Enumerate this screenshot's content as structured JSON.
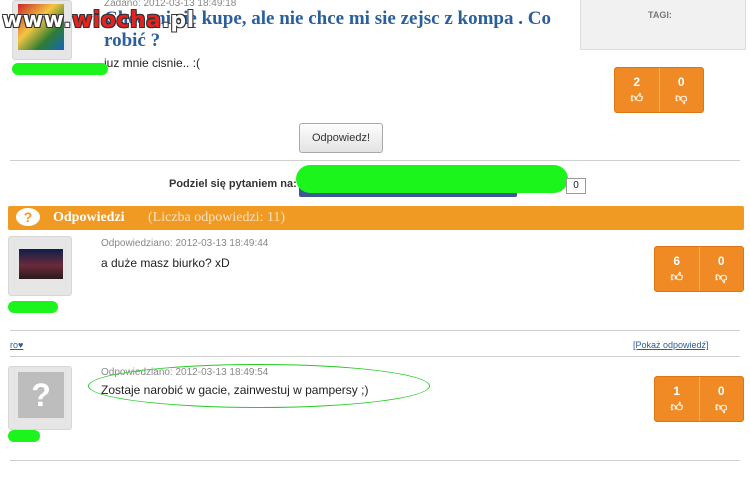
{
  "watermark": {
    "prefix": "www.",
    "red": "wiocha",
    "suffix": ".pl"
  },
  "question": {
    "date": "Zadano: 2012-03-13 18:49:18",
    "title": "Chce mi się kupe, ale nie chce mi sie zejsc z kompa . Co robić ?",
    "body": "juz mnie cisnie.. :(",
    "reply_button": "Odpowiedz!",
    "votes": {
      "up": "2",
      "down": "0"
    }
  },
  "tags": {
    "label": "TAGI:"
  },
  "share": {
    "label": "Podziel się pytaniem na:",
    "count": "0"
  },
  "answers_header": {
    "title": "Odpowiedzi",
    "count_text": "(Liczba odpowiedzi: 11)"
  },
  "answers": [
    {
      "date": "Odpowiedziano: 2012-03-13 18:49:44",
      "text": "a duże masz biurko? xD",
      "votes": {
        "up": "6",
        "down": "0"
      }
    },
    {
      "date": "Odpowiedziano: 2012-03-13 18:49:54",
      "text": "Zostaje narobić w gacie, zainwestuj w pampersy ;)",
      "votes": {
        "up": "1",
        "down": "0"
      }
    }
  ],
  "links": {
    "left": "ro♥",
    "show_answer": "[Pokaż odpowiedź]"
  },
  "icons": {
    "thumb_up": "thumb-up-icon",
    "thumb_down": "thumb-down-icon",
    "answers": "speech-bubble-icon"
  }
}
